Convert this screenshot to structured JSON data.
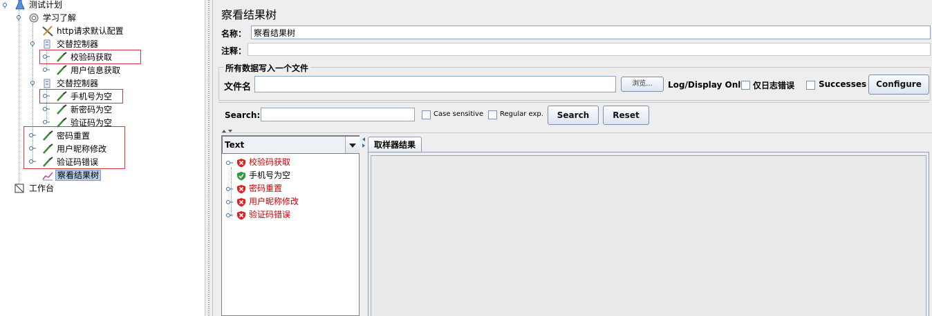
{
  "tree": {
    "nodes": [
      {
        "label": "测试计划",
        "icon": "test-plan-flask-icon"
      },
      {
        "label": "学习了解",
        "icon": "thread-group-gear-icon"
      },
      {
        "label": "http请求默认配置",
        "icon": "config-wrench-icon"
      },
      {
        "label": "交替控制器",
        "icon": "controller-icon"
      },
      {
        "label": "校验码获取",
        "icon": "sampler-pipette-icon"
      },
      {
        "label": "用户信息获取",
        "icon": "sampler-pipette-icon"
      },
      {
        "label": "交替控制器",
        "icon": "controller-icon"
      },
      {
        "label": "手机号为空",
        "icon": "sampler-pipette-icon"
      },
      {
        "label": "新密码为空",
        "icon": "sampler-pipette-icon"
      },
      {
        "label": "验证码为空",
        "icon": "sampler-pipette-icon"
      },
      {
        "label": "密码重置",
        "icon": "sampler-pipette-icon"
      },
      {
        "label": "用户昵称修改",
        "icon": "sampler-pipette-icon"
      },
      {
        "label": "验证码错误",
        "icon": "sampler-pipette-icon"
      },
      {
        "label": "察看结果树",
        "icon": "listener-graph-icon"
      },
      {
        "label": "工作台",
        "icon": "workbench-icon"
      }
    ]
  },
  "panel": {
    "title": "察看结果树",
    "name_label": "名称：",
    "name_value": "察看结果树",
    "comment_label": "注释：",
    "comment_value": "",
    "file_group_title": "所有数据写入一个文件",
    "filename_label": "文件名",
    "filename_value": "",
    "browse_label": "浏览...",
    "log_display_label": "Log/Display Only:",
    "errors_only_label": "仅日志错误",
    "successes_label": "Successes",
    "configure_label": "Configure",
    "search_label": "Search:",
    "search_value": "",
    "case_sensitive_label": "Case sensitive",
    "regex_label": "Regular exp.",
    "search_button": "Search",
    "reset_button": "Reset"
  },
  "results": {
    "renderer": "Text",
    "items": [
      {
        "label": "校验码获取",
        "status": "error"
      },
      {
        "label": "手机号为空",
        "status": "success"
      },
      {
        "label": "密码重置",
        "status": "error"
      },
      {
        "label": "用户昵称修改",
        "status": "error"
      },
      {
        "label": "验证码错误",
        "status": "error"
      }
    ],
    "tab_label": "取样器结果"
  },
  "colors": {
    "error_text": "#cc0000",
    "highlight_box": "#d9333a",
    "selection": "#b8cfe5"
  }
}
